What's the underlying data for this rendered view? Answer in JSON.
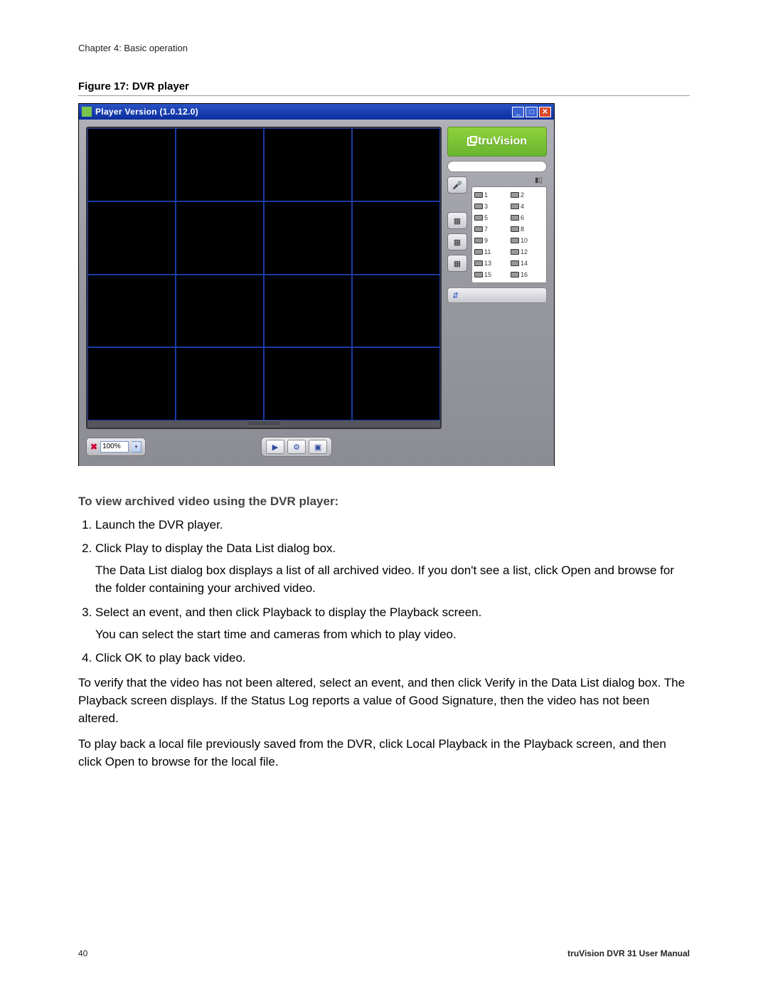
{
  "chapter": "Chapter 4: Basic operation",
  "figure_caption": "Figure 17: DVR player",
  "player": {
    "title": "Player Version (1.0.12.0)",
    "logo": "truVision",
    "zoom_value": "100%",
    "channels": [
      "1",
      "2",
      "3",
      "4",
      "5",
      "6",
      "7",
      "8",
      "9",
      "10",
      "11",
      "12",
      "13",
      "14",
      "15",
      "16"
    ]
  },
  "heading": "To view archived video using the DVR player:",
  "steps": [
    {
      "text": "Launch the DVR player."
    },
    {
      "text": "Click Play to display the Data List dialog box.",
      "sub": "The Data List dialog box displays a list of all archived video. If you don't see a list, click Open and browse for the folder containing your archived video."
    },
    {
      "text": "Select an event, and then click Playback to display the Playback screen.",
      "sub": "You can select the start time and cameras from which to play video."
    },
    {
      "text": "Click OK to play back video."
    }
  ],
  "para1": "To verify that the video has not been altered, select an event, and then click Verify in the Data List dialog box. The Playback screen displays. If the Status Log reports a value of Good Signature, then the video has not been altered.",
  "para2": "To play back a local file previously saved from the DVR, click Local Playback in the Playback screen, and then click Open to browse for the local file.",
  "footer": {
    "page": "40",
    "manual": "truVision DVR 31 User Manual"
  }
}
